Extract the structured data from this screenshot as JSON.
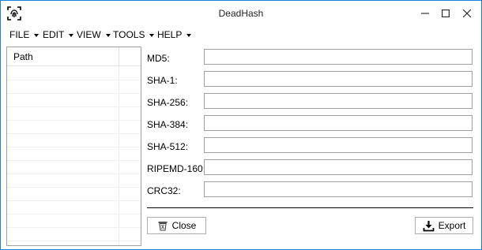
{
  "window": {
    "title": "DeadHash",
    "border_color": "#1e7fd6"
  },
  "titlebar_icons": {
    "app": "fingerprint-icon",
    "minimize": "minimize-icon",
    "maximize": "maximize-icon",
    "close": "close-icon"
  },
  "menu": [
    {
      "label": "FILE"
    },
    {
      "label": "EDIT"
    },
    {
      "label": "VIEW"
    },
    {
      "label": "TOOLS"
    },
    {
      "label": "HELP"
    }
  ],
  "filelist": {
    "columns": [
      "Path"
    ]
  },
  "hashes": [
    {
      "label": "MD5:",
      "value": ""
    },
    {
      "label": "SHA-1:",
      "value": ""
    },
    {
      "label": "SHA-256:",
      "value": ""
    },
    {
      "label": "SHA-384:",
      "value": ""
    },
    {
      "label": "SHA-512:",
      "value": ""
    },
    {
      "label": "RIPEMD-160:",
      "value": ""
    },
    {
      "label": "CRC32:",
      "value": ""
    }
  ],
  "buttons": {
    "close": {
      "label": "Close",
      "icon": "trash-icon"
    },
    "export": {
      "label": "Export",
      "icon": "download-icon"
    }
  }
}
